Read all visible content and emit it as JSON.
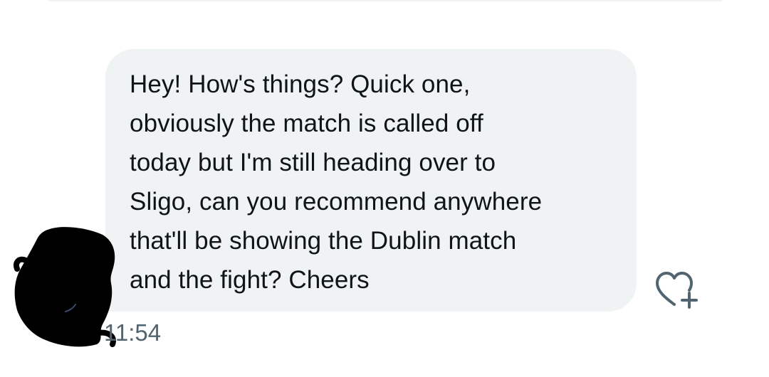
{
  "message": {
    "text": "Hey! How's things? Quick one,\nobviously the match is called off\ntoday but I'm still heading over to\nSligo, can you recommend anywhere\nthat'll be showing the Dublin match\nand the fight? Cheers",
    "timestamp": "11:54"
  },
  "actions": {
    "react_icon": "heart-plus-icon"
  },
  "avatar": {
    "state": "redacted"
  },
  "colors": {
    "bubble_background": "#eff3f4",
    "text": "#0f1419",
    "secondary_text": "#536471",
    "icon": "#536471",
    "redaction": "#000000"
  }
}
